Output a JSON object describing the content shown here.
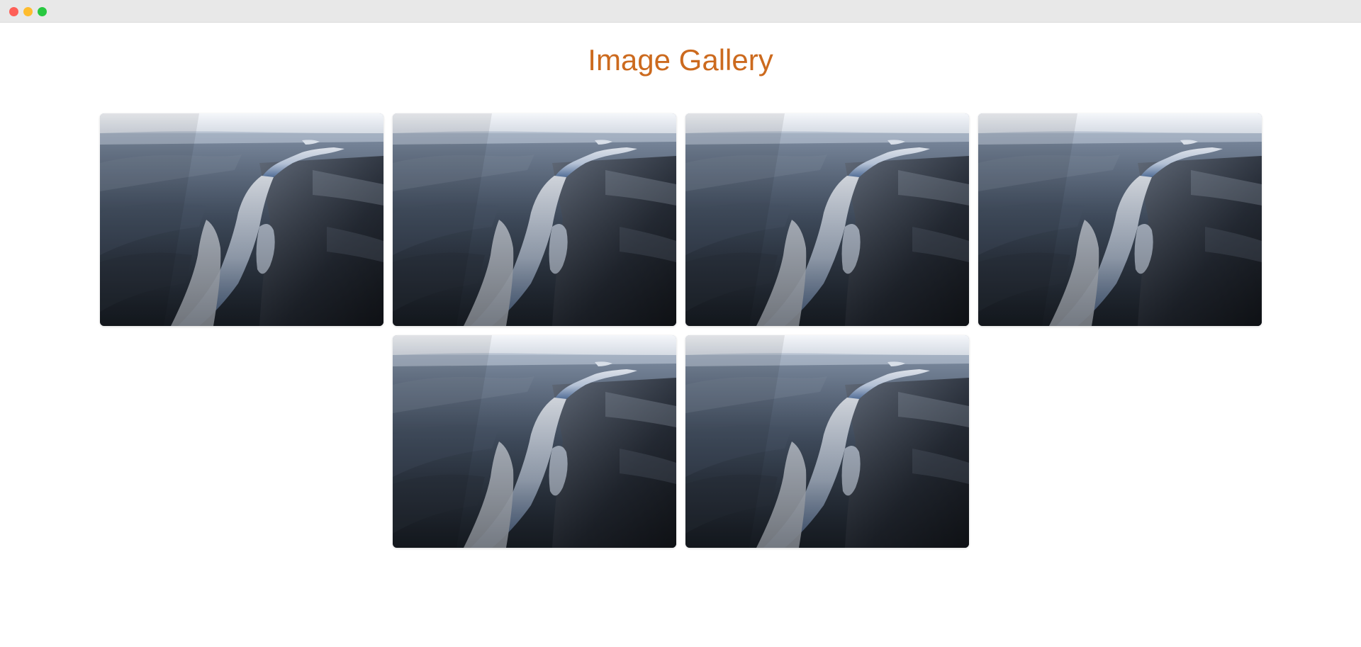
{
  "window": {
    "controls": [
      "close",
      "minimize",
      "maximize"
    ],
    "colors": {
      "close": "#fe5f57",
      "minimize": "#febc2e",
      "maximize": "#28c840"
    }
  },
  "page": {
    "title": "Image Gallery",
    "title_color": "#cc6a1e"
  },
  "gallery": {
    "images": [
      {
        "subject": "aerial-waterfall-canyon-photo"
      },
      {
        "subject": "aerial-waterfall-canyon-photo"
      },
      {
        "subject": "aerial-waterfall-canyon-photo"
      },
      {
        "subject": "aerial-waterfall-canyon-photo"
      },
      {
        "subject": "aerial-waterfall-canyon-photo"
      },
      {
        "subject": "aerial-waterfall-canyon-photo"
      }
    ]
  }
}
